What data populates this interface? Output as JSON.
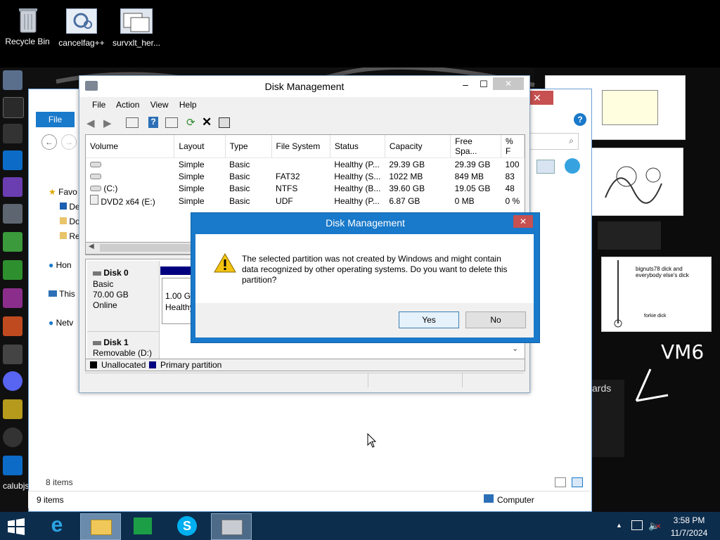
{
  "desktop": {
    "icons": [
      {
        "label": "Recycle Bin"
      },
      {
        "label": "cancelfag++"
      },
      {
        "label": "survxlt_her..."
      }
    ],
    "corner_label": "calubjs",
    "vm_scrawl": "VM6",
    "pic_text": "bignuts78 dick and everybody else's dick",
    "pic_text2": "forkie dick",
    "pic_text3": "ards"
  },
  "explorer": {
    "file_tab": "File",
    "nav": [
      "Favo",
      "De",
      "Do",
      "Re",
      "Hon",
      "This",
      "Netv"
    ],
    "items_count": "8 items",
    "status_items": "9 items",
    "status_location": "Computer"
  },
  "disk_mgmt": {
    "title": "Disk Management",
    "menu": [
      "File",
      "Action",
      "View",
      "Help"
    ],
    "columns": [
      "Volume",
      "Layout",
      "Type",
      "File System",
      "Status",
      "Capacity",
      "Free Spa...",
      "% F"
    ],
    "rows": [
      {
        "volume": "",
        "layout": "Simple",
        "type": "Basic",
        "fs": "",
        "status": "Healthy (P...",
        "capacity": "29.39 GB",
        "free": "29.39 GB",
        "pct": "100"
      },
      {
        "volume": "",
        "layout": "Simple",
        "type": "Basic",
        "fs": "FAT32",
        "status": "Healthy (S...",
        "capacity": "1022 MB",
        "free": "849 MB",
        "pct": "83"
      },
      {
        "volume": "(C:)",
        "layout": "Simple",
        "type": "Basic",
        "fs": "NTFS",
        "status": "Healthy (B...",
        "capacity": "39.60 GB",
        "free": "19.05 GB",
        "pct": "48"
      },
      {
        "volume": "DVD2 x64 (E:)",
        "layout": "Simple",
        "type": "Basic",
        "fs": "UDF",
        "status": "Healthy (P...",
        "capacity": "6.87 GB",
        "free": "0 MB",
        "pct": "0 %"
      }
    ],
    "disk0": {
      "name": "Disk 0",
      "type": "Basic",
      "size": "70.00 GB",
      "state": "Online",
      "part_size": "1.00 GE",
      "part_status": "Healthy"
    },
    "disk1": {
      "name": "Disk 1",
      "type": "Removable (D:)"
    },
    "legend": {
      "unallocated": "Unallocated",
      "primary": "Primary partition"
    }
  },
  "dialog": {
    "title": "Disk Management",
    "message": "The selected partition was not created by Windows and might contain data recognized by other operating systems. Do you want to delete this partition?",
    "yes": "Yes",
    "no": "No"
  },
  "taskbar": {
    "time": "3:58 PM",
    "date": "11/7/2024"
  },
  "colors": {
    "accent": "#1979ca",
    "taskbar": "#0d2d4d",
    "primary_partition": "#00007f"
  }
}
